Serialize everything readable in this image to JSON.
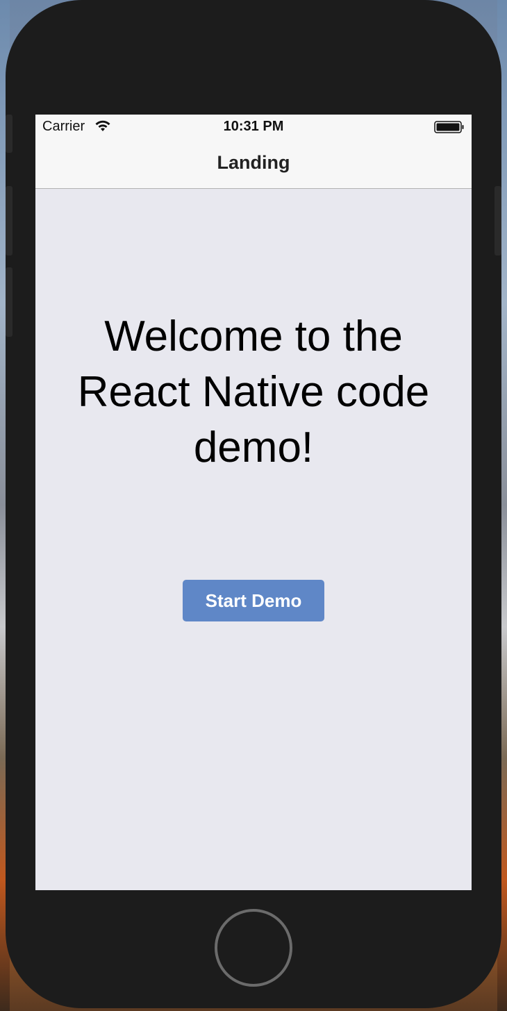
{
  "status_bar": {
    "carrier": "Carrier",
    "time": "10:31 PM",
    "wifi_icon": "wifi-icon",
    "battery_icon": "battery-icon"
  },
  "nav_bar": {
    "title": "Landing"
  },
  "main": {
    "welcome_text": "Welcome to the React Native code demo!",
    "start_button_label": "Start Demo"
  },
  "device": {
    "home_button_icon": "home-button"
  },
  "colors": {
    "screen_background": "#e8e8ef",
    "bar_background": "#f7f7f7",
    "button_accent": "#5f87c7",
    "device_body": "#1c1c1c"
  }
}
